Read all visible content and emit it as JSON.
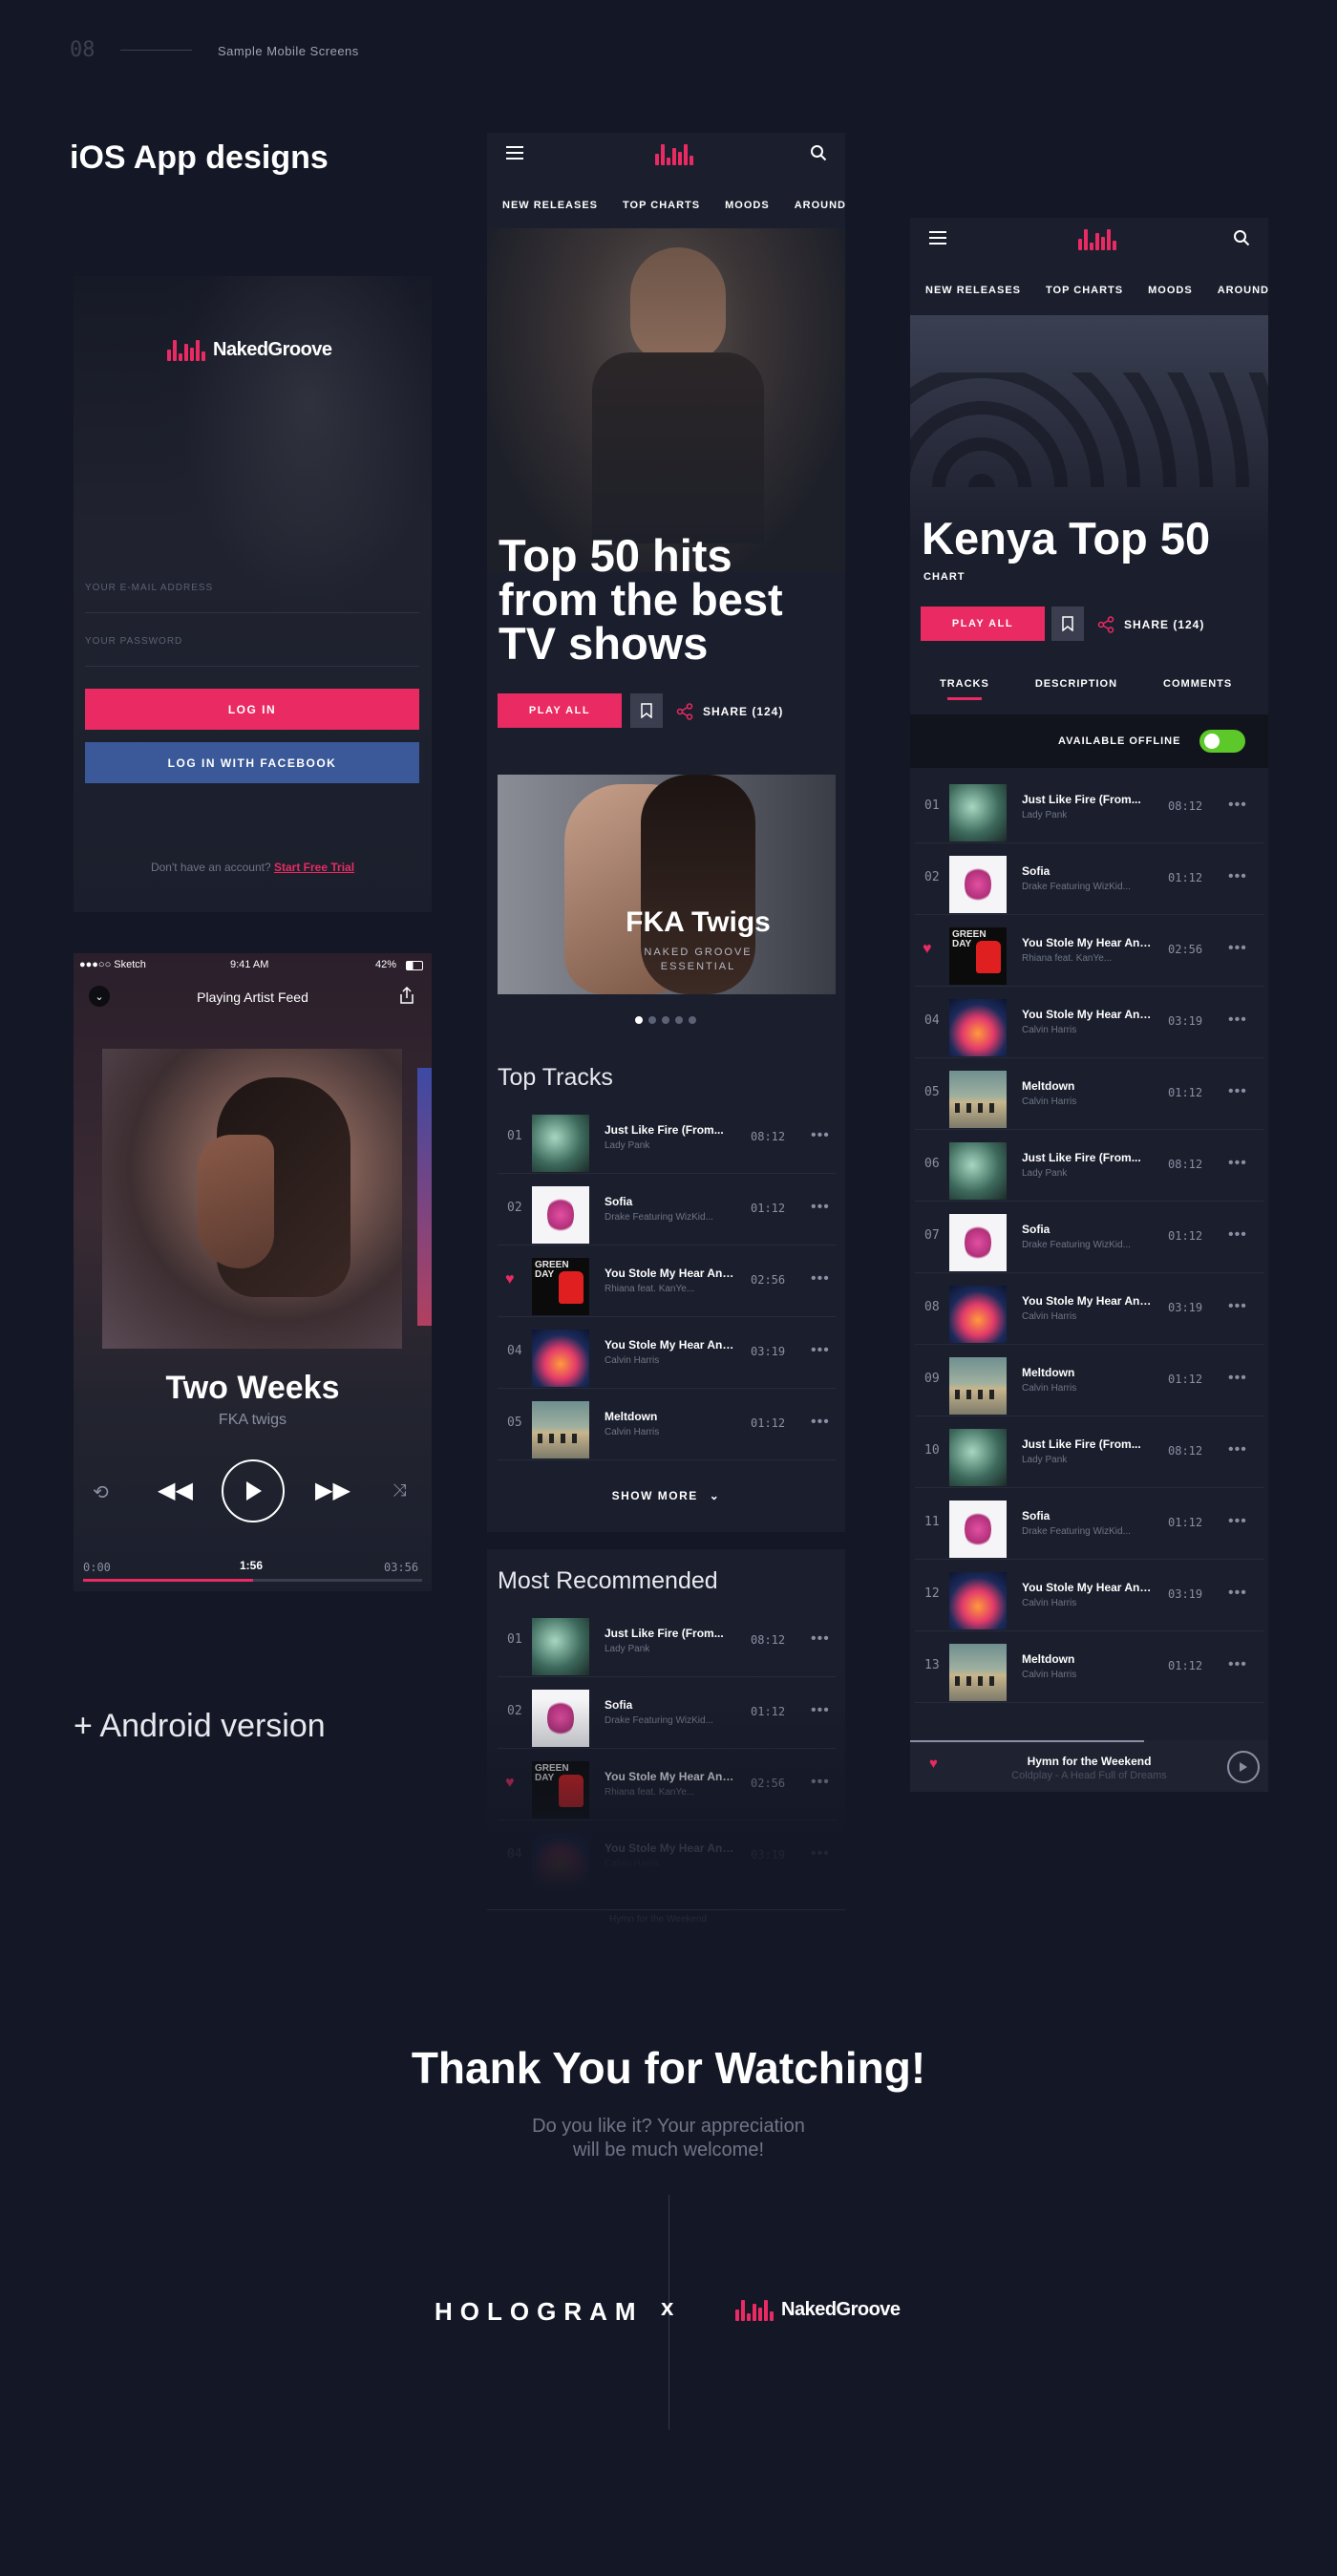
{
  "header": {
    "page_num": "08",
    "section_label": "Sample Mobile Screens",
    "left_title": "iOS App designs"
  },
  "login": {
    "brand": "NakedGroove",
    "email_placeholder": "YOUR E-MAIL ADDRESS",
    "password_placeholder": "YOUR PASSWORD",
    "login_label": "LOG IN",
    "facebook_label": "LOG IN WITH FACEBOOK",
    "no_account_text": "Don't have an account?",
    "trial_link": "Start Free Trial"
  },
  "player": {
    "carrier": "●●●○○ Sketch",
    "clock": "9:41 AM",
    "battery": "42%",
    "header_title": "Playing Artist Feed",
    "song_title": "Two Weeks",
    "song_artist": "FKA twigs",
    "time_elapsed": "0:00",
    "time_marker": "1:56",
    "time_total": "03:56",
    "progress": 0.5
  },
  "android_label": "+ Android version",
  "nav_tabs": [
    "NEW RELEASES",
    "TOP CHARTS",
    "MOODS",
    "AROUND"
  ],
  "charts_screen": {
    "hero_title_lines": [
      "Top 50 hits",
      "from the best",
      "TV shows"
    ],
    "play_all": "PLAY ALL",
    "share_label": "SHARE (124)",
    "featured_title": "FKA Twigs",
    "featured_sub1": "NAKED GROOVE",
    "featured_sub2": "ESSENTIAL",
    "top_tracks_heading": "Top Tracks",
    "top_tracks": [
      {
        "marker": "01",
        "title": "Just Like Fire (From...",
        "artist": "Lady Pank",
        "duration": "08:12",
        "thumb": "green"
      },
      {
        "marker": "02",
        "title": "Sofia",
        "artist": "Drake Featuring WizKid...",
        "duration": "01:12",
        "thumb": "pink"
      },
      {
        "marker": "heart",
        "title": "You Stole My Hear And...",
        "artist": "Rhiana feat. KanYe...",
        "duration": "02:56",
        "thumb": "gd"
      },
      {
        "marker": "04",
        "title": "You Stole My Hear And...",
        "artist": "Calvin Harris",
        "duration": "03:19",
        "thumb": "cal"
      },
      {
        "marker": "05",
        "title": "Meltdown",
        "artist": "Calvin Harris",
        "duration": "01:12",
        "thumb": "abbey"
      }
    ],
    "show_more": "SHOW MORE",
    "recommended_heading": "Most Recommended",
    "recommended": [
      {
        "marker": "01",
        "title": "Just Like Fire (From...",
        "artist": "Lady Pank",
        "duration": "08:12",
        "thumb": "green"
      },
      {
        "marker": "02",
        "title": "Sofia",
        "artist": "Drake Featuring WizKid...",
        "duration": "01:12",
        "thumb": "pink"
      },
      {
        "marker": "heart",
        "title": "You Stole My Hear And...",
        "artist": "Rhiana feat. KanYe...",
        "duration": "02:56",
        "thumb": "gd"
      },
      {
        "marker": "04",
        "title": "You Stole My Hear And...",
        "artist": "Calvin Harris",
        "duration": "03:19",
        "thumb": "cal"
      }
    ],
    "mini_player": "Hymn for the Weekend"
  },
  "kenya_screen": {
    "title": "Kenya Top 50",
    "subtitle": "CHART",
    "play_all": "PLAY ALL",
    "share_label": "SHARE (124)",
    "subtabs": [
      "TRACKS",
      "DESCRIPTION",
      "COMMENTS"
    ],
    "offline_label": "AVAILABLE OFFLINE",
    "tracks": [
      {
        "marker": "01",
        "title": "Just Like Fire (From...",
        "artist": "Lady Pank",
        "duration": "08:12",
        "thumb": "green"
      },
      {
        "marker": "02",
        "title": "Sofia",
        "artist": "Drake Featuring WizKid...",
        "duration": "01:12",
        "thumb": "pink"
      },
      {
        "marker": "heart",
        "title": "You Stole My Hear And...",
        "artist": "Rhiana feat. KanYe...",
        "duration": "02:56",
        "thumb": "gd"
      },
      {
        "marker": "04",
        "title": "You Stole My Hear And...",
        "artist": "Calvin Harris",
        "duration": "03:19",
        "thumb": "cal"
      },
      {
        "marker": "05",
        "title": "Meltdown",
        "artist": "Calvin Harris",
        "duration": "01:12",
        "thumb": "abbey"
      },
      {
        "marker": "06",
        "title": "Just Like Fire (From...",
        "artist": "Lady Pank",
        "duration": "08:12",
        "thumb": "green"
      },
      {
        "marker": "07",
        "title": "Sofia",
        "artist": "Drake Featuring WizKid...",
        "duration": "01:12",
        "thumb": "pink"
      },
      {
        "marker": "08",
        "title": "You Stole My Hear And...",
        "artist": "Calvin Harris",
        "duration": "03:19",
        "thumb": "cal"
      },
      {
        "marker": "09",
        "title": "Meltdown",
        "artist": "Calvin Harris",
        "duration": "01:12",
        "thumb": "abbey"
      },
      {
        "marker": "10",
        "title": "Just Like Fire (From...",
        "artist": "Lady Pank",
        "duration": "08:12",
        "thumb": "green"
      },
      {
        "marker": "11",
        "title": "Sofia",
        "artist": "Drake Featuring WizKid...",
        "duration": "01:12",
        "thumb": "pink"
      },
      {
        "marker": "12",
        "title": "You Stole My Hear And...",
        "artist": "Calvin Harris",
        "duration": "03:19",
        "thumb": "cal"
      },
      {
        "marker": "13",
        "title": "Meltdown",
        "artist": "Calvin Harris",
        "duration": "01:12",
        "thumb": "abbey"
      }
    ],
    "mini_title": "Hymn for the Weekend",
    "mini_sub": "Coldplay - A Head Full of Dreams"
  },
  "footer": {
    "thanks": "Thank You for Watching!",
    "sub_line1": "Do you like it? Your appreciation",
    "sub_line2": "will be much welcome!",
    "hologram": "HOLOGRAM",
    "times": "x",
    "partner": "NakedGroove"
  },
  "colors": {
    "accent": "#ea2a62",
    "background": "#141826",
    "facebook": "#3b5998",
    "toggle": "#5cc82a"
  }
}
